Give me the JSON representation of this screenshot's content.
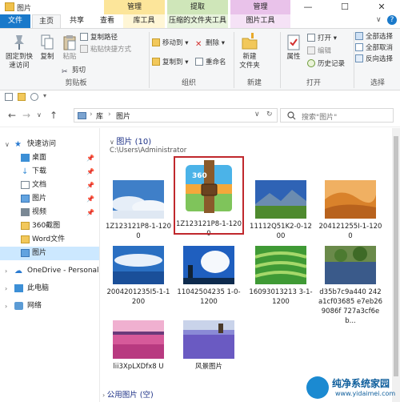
{
  "window": {
    "title": "图片",
    "context_tabs": [
      "管理",
      "提取",
      "管理"
    ],
    "minimize": "—",
    "maximize": "☐",
    "close": "✕"
  },
  "ribbon_tabs": [
    "文件",
    "主页",
    "共享",
    "查看",
    "库工具",
    "压缩的文件夹工具",
    "图片工具"
  ],
  "ribbon": {
    "clipboard": {
      "pin": "固定到快\n速访问",
      "copy": "复制",
      "paste": "粘贴",
      "copy_path": "复制路径",
      "paste_shortcut": "粘贴快捷方式",
      "cut": "剪切",
      "label": "剪贴板"
    },
    "organize": {
      "move_to": "移动到",
      "copy_to": "复制到",
      "delete": "删除",
      "rename": "重命名",
      "label": "组织"
    },
    "new": {
      "new_folder": "新建\n文件夹",
      "label": "新建"
    },
    "open": {
      "properties": "属性",
      "open": "打开",
      "edit": "编辑",
      "history": "历史记录",
      "label": "打开"
    },
    "select": {
      "select_all": "全部选择",
      "select_none": "全部取消",
      "invert": "反向选择",
      "label": "选择"
    }
  },
  "address": {
    "back": "←",
    "forward": "→",
    "recent": "∨",
    "up": "↑",
    "crumbs": [
      "库",
      "图片"
    ],
    "search_placeholder": "搜索\"图片\""
  },
  "nav": {
    "quick_access": "快速访问",
    "items": [
      "桌面",
      "下载",
      "文档",
      "图片",
      "视频",
      "360截图",
      "Word文件",
      "图片"
    ],
    "onedrive": "OneDrive - Personal",
    "this_pc": "此电脑",
    "network": "网络"
  },
  "content": {
    "group_title": "图片 (10)",
    "group_path": "C:\\Users\\Administrator",
    "files": [
      "1Z123121P8-1-1200",
      "1Z123121P8-1-1200",
      "11112Q51K2-0-1200",
      "204121255I-1-1200",
      "2004201235I5-1-1200",
      "11042504235 1-0-1200",
      "16093013213 3-1-1200",
      "d35b7c9a440 242a1cf03685 e7eb269086f 727a3cf6eb...",
      "lii3XpLXDfx8 U",
      "风景图片"
    ],
    "public_group": "公用图片 (空)"
  },
  "watermark": {
    "name": "纯净系统家园",
    "url": "www.yidaimei.com"
  }
}
